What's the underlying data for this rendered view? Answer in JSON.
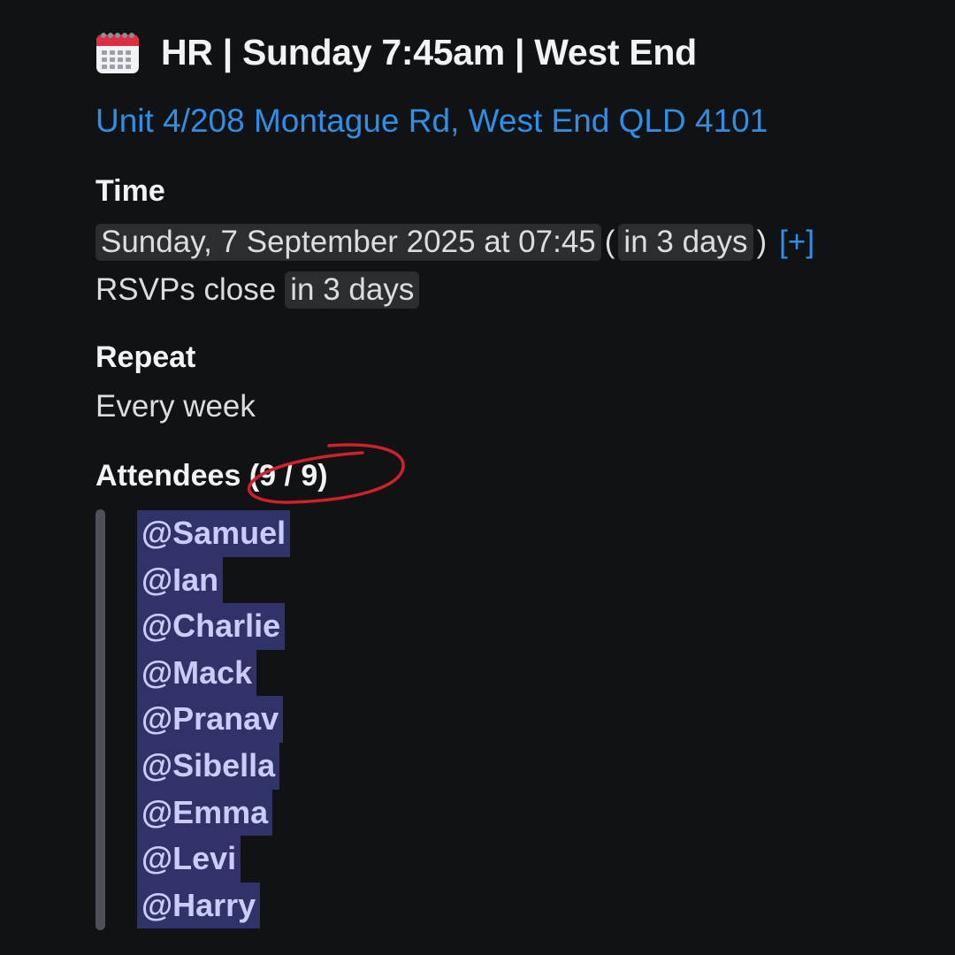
{
  "event": {
    "title": "HR | Sunday 7:45am | West End",
    "title_icon": "calendar-icon",
    "address": "Unit 4/208 Montague Rd, West End QLD 4101"
  },
  "time": {
    "label": "Time",
    "datetime": "Sunday, 7 September 2025 at 07:45",
    "open_paren": "(",
    "relative": "in 3 days",
    "close_paren": ")",
    "add_link": "[+]",
    "rsvp_prefix": "RSVPs close",
    "rsvp_relative": "in 3 days"
  },
  "repeat": {
    "label": "Repeat",
    "value": "Every week"
  },
  "attendees": {
    "label": "Attendees",
    "count": "(9 / 9)",
    "list": [
      "@Samuel",
      "@Ian",
      "@Charlie",
      "@Mack",
      "@Pranav",
      "@Sibella",
      "@Emma",
      "@Levi",
      "@Harry"
    ]
  },
  "colors": {
    "background": "#111214",
    "link": "#2f8ee6",
    "mention_bg": "#2f3369",
    "mention_text": "#c9cdfb",
    "annotation": "#d0202a"
  }
}
